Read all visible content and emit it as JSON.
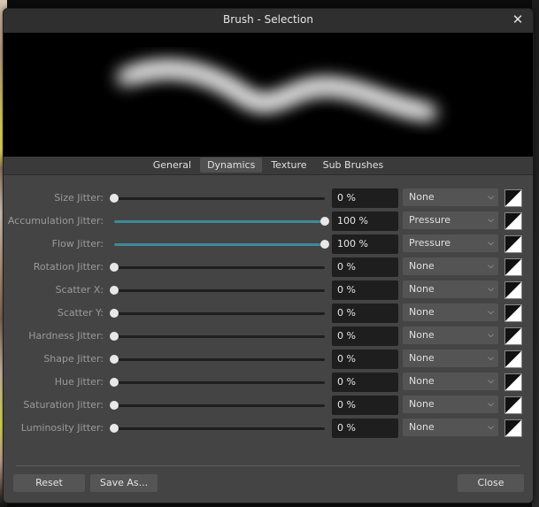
{
  "dialog": {
    "title": "Brush - Selection"
  },
  "tabs": [
    {
      "label": "General"
    },
    {
      "label": "Dynamics"
    },
    {
      "label": "Texture"
    },
    {
      "label": "Sub Brushes"
    }
  ],
  "active_tab": "Dynamics",
  "rows": [
    {
      "label": "Size Jitter:",
      "value": "0 %",
      "level": 0,
      "controller": "None"
    },
    {
      "label": "Accumulation Jitter:",
      "value": "100 %",
      "level": 1,
      "controller": "Pressure"
    },
    {
      "label": "Flow Jitter:",
      "value": "100 %",
      "level": 1,
      "controller": "Pressure"
    },
    {
      "label": "Rotation Jitter:",
      "value": "0 %",
      "level": 0,
      "controller": "None"
    },
    {
      "label": "Scatter X:",
      "value": "0 %",
      "level": 0,
      "controller": "None"
    },
    {
      "label": "Scatter Y:",
      "value": "0 %",
      "level": 0,
      "controller": "None"
    },
    {
      "label": "Hardness Jitter:",
      "value": "0 %",
      "level": 0,
      "controller": "None"
    },
    {
      "label": "Shape Jitter:",
      "value": "0 %",
      "level": 0,
      "controller": "None"
    },
    {
      "label": "Hue Jitter:",
      "value": "0 %",
      "level": 0,
      "controller": "None"
    },
    {
      "label": "Saturation Jitter:",
      "value": "0 %",
      "level": 0,
      "controller": "None"
    },
    {
      "label": "Luminosity Jitter:",
      "value": "0 %",
      "level": 0,
      "controller": "None"
    }
  ],
  "buttons": {
    "reset": "Reset",
    "save_as": "Save As...",
    "close": "Close"
  },
  "icons": {
    "close": "close-icon",
    "dropdown": "chevron-down-icon",
    "curve": "pressure-curve-icon"
  },
  "colors": {
    "slider_fill": "#3f8a98",
    "dialog_bg": "#444444",
    "preview_bg": "#000000"
  }
}
